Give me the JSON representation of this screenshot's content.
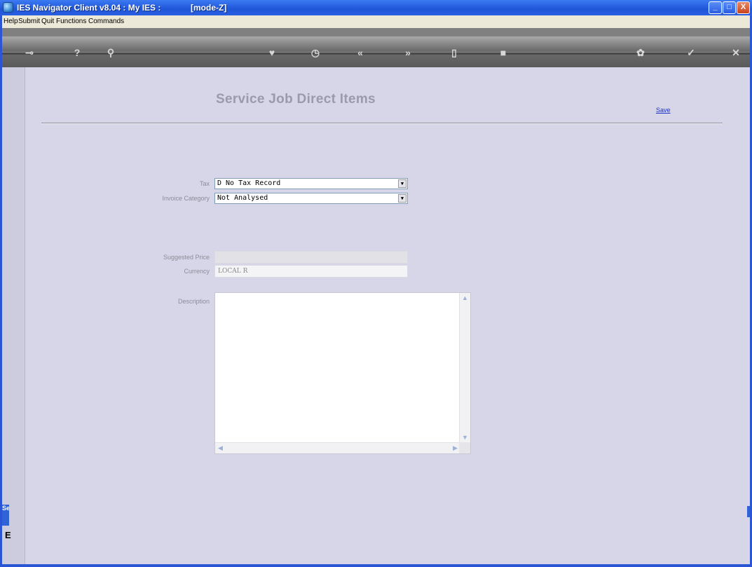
{
  "window": {
    "title": "IES Navigator Client v8.04 : My IES :",
    "mode": "[mode-Z]",
    "min_glyph": "_",
    "max_glyph": "□",
    "close_glyph": "X"
  },
  "menu": {
    "items": [
      "Help",
      "Submit",
      "Quit",
      "Functions",
      "Commands"
    ]
  },
  "toolbar": {
    "icons": [
      "key-icon",
      "help-icon",
      "search-icon",
      "heart-icon",
      "clock-icon",
      "rewind-icon",
      "forward-icon",
      "document-icon",
      "stop-icon",
      "settings-icon",
      "check-icon",
      "close-icon"
    ]
  },
  "page": {
    "title": "Service Job Direct Items",
    "save_label": "Save"
  },
  "form": {
    "tax_label": "Tax",
    "tax_value": "D No Tax Record",
    "invoice_category_label": "Invoice Category",
    "invoice_category_value": "Not Analysed",
    "suggested_price_label": "Suggested Price",
    "suggested_price_value": "",
    "currency_label": "Currency",
    "currency_value": "LOCAL R",
    "description_label": "Description",
    "description_value": ""
  },
  "side": {
    "tab_text": "Se",
    "letter": "E"
  },
  "colors": {
    "titlebar": "#2a5fe0",
    "client_bg": "#d6d6e8",
    "link": "#1a2ec8"
  }
}
